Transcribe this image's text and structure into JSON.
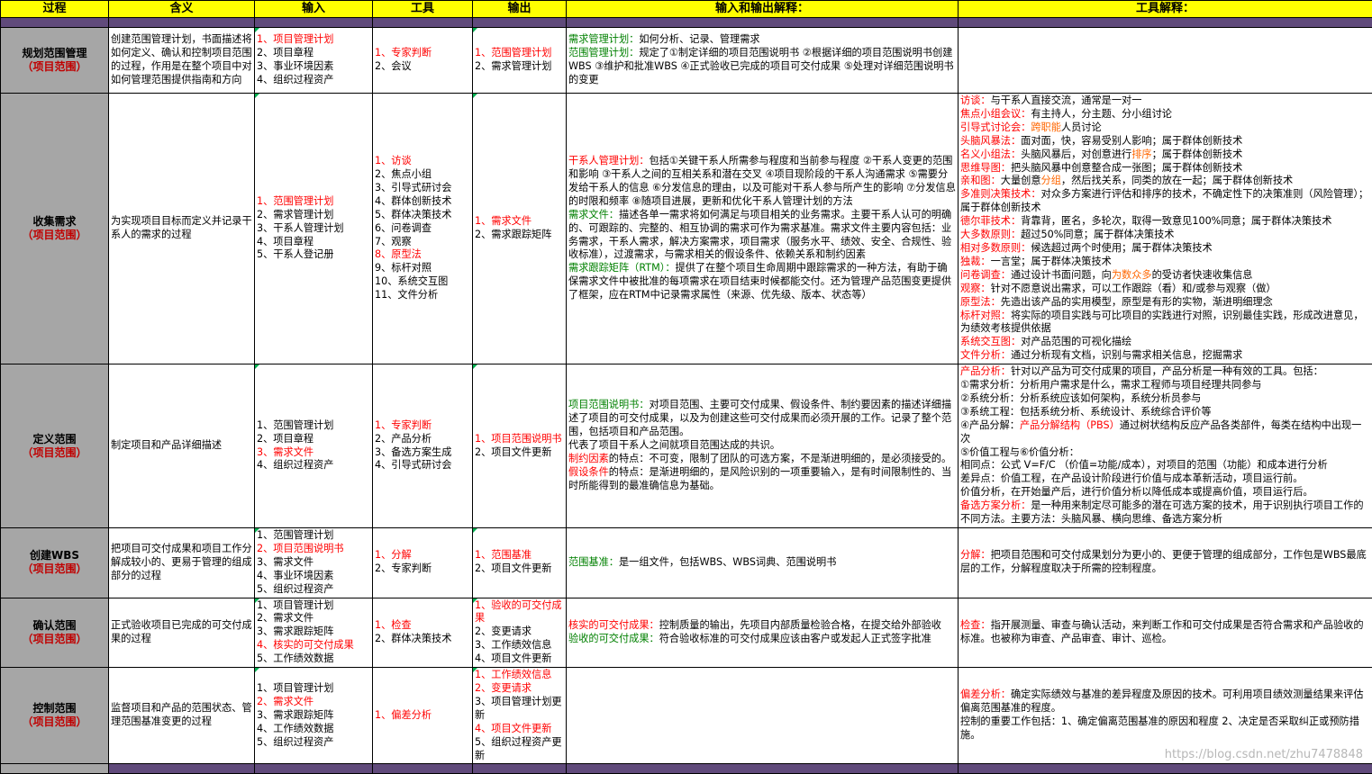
{
  "headers": [
    "过程",
    "含义",
    "输入",
    "工具",
    "输出",
    "输入和输出解释：",
    "工具解释："
  ],
  "rows": [
    {
      "process": "规划范围管理",
      "area": "（项目范围）",
      "meaning": "创建范围管理计划，书面描述将如何定义、确认和控制项目范围的过程，作用是在整个项目中对如何管理范围提供指南和方向",
      "inputs": [
        {
          "t": "1、项目管理计划",
          "c": "red"
        },
        {
          "t": "2、项目章程",
          "c": ""
        },
        {
          "t": "3、事业环境因素",
          "c": ""
        },
        {
          "t": "4、组织过程资产",
          "c": ""
        }
      ],
      "tools": [
        {
          "t": "1、专家判断",
          "c": "red"
        },
        {
          "t": "2、会议",
          "c": ""
        }
      ],
      "outputs": [
        {
          "t": "1、范围管理计划",
          "c": "red"
        },
        {
          "t": "2、需求管理计划",
          "c": ""
        }
      ],
      "io_explain": [
        [
          {
            "t": "需求管理计划：",
            "c": "green"
          },
          {
            "t": "如何分析、记录、管理需求",
            "c": ""
          }
        ],
        [
          {
            "t": "范围管理计划：",
            "c": "green"
          },
          {
            "t": "规定了①制定详细的项目范围说明书 ②根据详细的项目范围说明书创建WBS ③维护和批准WBS ④正式验收已完成的项目可交付成果 ⑤处理对详细范围说明书的变更",
            "c": ""
          }
        ]
      ],
      "tool_explain": []
    },
    {
      "process": "收集需求",
      "area": "（项目范围）",
      "meaning": "为实现项目目标而定义并记录干系人的需求的过程",
      "inputs": [
        {
          "t": "1、范围管理计划",
          "c": "red"
        },
        {
          "t": "2、需求管理计划",
          "c": ""
        },
        {
          "t": "3、干系人管理计划",
          "c": ""
        },
        {
          "t": "4、项目章程",
          "c": ""
        },
        {
          "t": "5、干系人登记册",
          "c": ""
        }
      ],
      "tools": [
        {
          "t": "1、访谈",
          "c": "red"
        },
        {
          "t": "2、焦点小组",
          "c": ""
        },
        {
          "t": "3、引导式研讨会",
          "c": ""
        },
        {
          "t": "4、群体创新技术",
          "c": ""
        },
        {
          "t": "5、群体决策技术",
          "c": ""
        },
        {
          "t": "6、问卷调查",
          "c": ""
        },
        {
          "t": "7、观察",
          "c": ""
        },
        {
          "t": "8、原型法",
          "c": "red"
        },
        {
          "t": "9、标杆对照",
          "c": ""
        },
        {
          "t": "10、系统交互图",
          "c": ""
        },
        {
          "t": "11、文件分析",
          "c": ""
        }
      ],
      "outputs": [
        {
          "t": "1、需求文件",
          "c": "red"
        },
        {
          "t": "2、需求跟踪矩阵",
          "c": ""
        }
      ],
      "io_explain": [
        [
          {
            "t": "干系人管理计划：",
            "c": "red"
          },
          {
            "t": "包括①关键干系人所需参与程度和当前参与程度 ②干系人变更的范围和影响 ③干系人之间的互相关系和潜在交叉 ④项目现阶段的干系人沟通需求 ⑤需要分发给干系人的信息 ⑥分发信息的理由，以及可能对干系人参与所产生的影响 ⑦分发信息的时限和频率 ⑧随项目进展，更新和优化干系人管理计划的方法",
            "c": ""
          }
        ],
        [
          {
            "t": "需求文件：",
            "c": "green"
          },
          {
            "t": "描述各单一需求将如何满足与项目相关的业务需求。主要干系人认可的明确的、可跟踪的、完整的、相互协调的需求可作为需求基准。需求文件主要内容包括：业务需求，干系人需求，解决方案需求，项目需求（服务水平、绩效、安全、合规性、验收标准），过渡需求，与需求相关的假设条件、依赖关系和制约因素",
            "c": ""
          }
        ],
        [
          {
            "t": "需求跟踪矩阵（RTM）：",
            "c": "green"
          },
          {
            "t": "提供了在整个项目生命周期中跟踪需求的一种方法，有助于确保需求文件中被批准的每项需求在项目结束时候都能交付。还为管理产品范围变更提供了框架，应在RTM中记录需求属性（来源、优先级、版本、状态等）",
            "c": ""
          }
        ]
      ],
      "tool_explain": [
        [
          {
            "t": "访谈：",
            "c": "red"
          },
          {
            "t": "与干系人直接交流，通常是一对一",
            "c": ""
          }
        ],
        [
          {
            "t": "焦点小组会议：",
            "c": "red"
          },
          {
            "t": "有主持人，分主题、分小组讨论",
            "c": ""
          }
        ],
        [
          {
            "t": "引导式讨论会：",
            "c": "red"
          },
          {
            "t": "跨职能",
            "c": "orange"
          },
          {
            "t": "人员讨论",
            "c": ""
          }
        ],
        [
          {
            "t": "头脑风暴法：",
            "c": "red"
          },
          {
            "t": "面对面，快，容易受别人影响；属于群体创新技术",
            "c": ""
          }
        ],
        [
          {
            "t": "名义小组法：",
            "c": "red"
          },
          {
            "t": "头脑风暴后，对创意进行",
            "c": ""
          },
          {
            "t": "排序",
            "c": "orange"
          },
          {
            "t": "；属于群体创新技术",
            "c": ""
          }
        ],
        [
          {
            "t": "思维导图：",
            "c": "red"
          },
          {
            "t": "把头脑风暴中创意整合成一张图；属于群体创新技术",
            "c": ""
          }
        ],
        [
          {
            "t": "亲和图：",
            "c": "red"
          },
          {
            "t": "大量创意",
            "c": ""
          },
          {
            "t": "分组",
            "c": "orange"
          },
          {
            "t": "，然后找关系，同类的放在一起；属于群体创新技术",
            "c": ""
          }
        ],
        [
          {
            "t": "多准则决策技术：",
            "c": "red"
          },
          {
            "t": "对众多方案进行评估和排序的技术，不确定性下的决策准则（风险管理）；属于群体创新技术",
            "c": ""
          }
        ],
        [
          {
            "t": "德尔菲技术：",
            "c": "red"
          },
          {
            "t": "背靠背，匿名，多轮次，取得一致意见100%同意；属于群体决策技术",
            "c": ""
          }
        ],
        [
          {
            "t": "大多数原则：",
            "c": "red"
          },
          {
            "t": "超过50%同意；属于群体决策技术",
            "c": ""
          }
        ],
        [
          {
            "t": "相对多数原则：",
            "c": "red"
          },
          {
            "t": "候选超过两个时使用；属于群体决策技术",
            "c": ""
          }
        ],
        [
          {
            "t": "独裁：",
            "c": "red"
          },
          {
            "t": "一言堂；属于群体决策技术",
            "c": ""
          }
        ],
        [
          {
            "t": "问卷调查：",
            "c": "red"
          },
          {
            "t": "通过设计书面问题，向",
            "c": ""
          },
          {
            "t": "为数众多",
            "c": "orange"
          },
          {
            "t": "的受访者快速收集信息",
            "c": ""
          }
        ],
        [
          {
            "t": "观察：",
            "c": "red"
          },
          {
            "t": "针对不愿意说出需求，可以工作跟踪（看）和/或参与观察（做）",
            "c": ""
          }
        ],
        [
          {
            "t": "原型法：",
            "c": "red"
          },
          {
            "t": "先造出该产品的实用模型，原型是有形的实物，渐进明细理念",
            "c": ""
          }
        ],
        [
          {
            "t": "标杆对照：",
            "c": "red"
          },
          {
            "t": "将实际的项目实践与可比项目的实践进行对照，识别最佳实践，形成改进意见，为绩效考核提供依据",
            "c": ""
          }
        ],
        [
          {
            "t": "系统交互图：",
            "c": "red"
          },
          {
            "t": "对产品范围的可视化描绘",
            "c": ""
          }
        ],
        [
          {
            "t": "文件分析：",
            "c": "red"
          },
          {
            "t": "通过分析现有文档，识别与需求相关信息，挖掘需求",
            "c": ""
          }
        ]
      ]
    },
    {
      "process": "定义范围",
      "area": "（项目范围）",
      "meaning": "制定项目和产品详细描述",
      "inputs": [
        {
          "t": "1、范围管理计划",
          "c": ""
        },
        {
          "t": "2、项目章程",
          "c": ""
        },
        {
          "t": "3、需求文件",
          "c": "red"
        },
        {
          "t": "4、组织过程资产",
          "c": ""
        }
      ],
      "tools": [
        {
          "t": "1、专家判断",
          "c": "red"
        },
        {
          "t": "2、产品分析",
          "c": ""
        },
        {
          "t": "3、备选方案生成",
          "c": ""
        },
        {
          "t": "4、引导式研讨会",
          "c": ""
        }
      ],
      "outputs": [
        {
          "t": "1、项目范围说明书",
          "c": "red"
        },
        {
          "t": "2、项目文件更新",
          "c": ""
        }
      ],
      "io_explain": [
        [
          {
            "t": "项目范围说明书：",
            "c": "green"
          },
          {
            "t": "对项目范围、主要可交付成果、假设条件、制约要因素的描述详细描述了项目的可交付成果，以及为创建这些可交付成果而必须开展的工作。记录了整个范围，包括项目和产品范围。",
            "c": ""
          }
        ],
        [
          {
            "t": "代表了项目干系人之间就项目范围达成的共识。",
            "c": ""
          }
        ],
        [
          {
            "t": "制约因素",
            "c": "red"
          },
          {
            "t": "的特点：不可变，限制了团队的可选方案，不是渐进明细的，是必须接受的。",
            "c": ""
          }
        ],
        [
          {
            "t": "假设条件",
            "c": "red"
          },
          {
            "t": "的特点：是渐进明细的，是风险识别的一项重要输入，是有时间限制性的、当时所能得到的最准确信息为基础。",
            "c": ""
          }
        ]
      ],
      "tool_explain": [
        [
          {
            "t": "产品分析：",
            "c": "red"
          },
          {
            "t": "针对以产品为可交付成果的项目，产品分析是一种有效的工具。包括：",
            "c": ""
          }
        ],
        [
          {
            "t": "①需求分析：分析用户需求是什么，需求工程师与项目经理共同参与",
            "c": ""
          }
        ],
        [
          {
            "t": "②系统分析：分析系统应该如何架构，系统分析员参与",
            "c": ""
          }
        ],
        [
          {
            "t": "③系统工程：包括系统分析、系统设计、系统综合评价等",
            "c": ""
          }
        ],
        [
          {
            "t": "④产品分解：",
            "c": ""
          },
          {
            "t": "产品分解结构（PBS）",
            "c": "red"
          },
          {
            "t": "通过树状结构反应产品各类部件，每类在结构中出现一次",
            "c": ""
          }
        ],
        [
          {
            "t": "⑤价值工程与⑥价值分析：",
            "c": ""
          }
        ],
        [
          {
            "t": "相同点：公式 V=F/C （价值=功能/成本），对项目的范围（功能）和成本进行分析",
            "c": ""
          }
        ],
        [
          {
            "t": "差异点：价值工程，在产品设计阶段进行价值与成本革新活动，项目运行前。",
            "c": ""
          }
        ],
        [
          {
            "t": "价值分析，在开始量产后，进行价值分析以降低成本或提高价值，项目运行后。",
            "c": ""
          }
        ],
        [
          {
            "t": "备选方案分析：",
            "c": "red"
          },
          {
            "t": "是一种用来制定尽可能多的潜在可选方案的技术，用于识别执行项目工作的不同方法。主要方法：头脑风暴、横向思维、备选方案分析",
            "c": ""
          }
        ]
      ]
    },
    {
      "process": "创建WBS",
      "area": "（项目范围）",
      "meaning": "把项目可交付成果和项目工作分解成较小的、更易于管理的组成部分的过程",
      "inputs": [
        {
          "t": "1、范围管理计划",
          "c": ""
        },
        {
          "t": "2、项目范围说明书",
          "c": "red"
        },
        {
          "t": "3、需求文件",
          "c": ""
        },
        {
          "t": "4、事业环境因素",
          "c": ""
        },
        {
          "t": "5、组织过程资产",
          "c": ""
        }
      ],
      "tools": [
        {
          "t": "1、分解",
          "c": "red"
        },
        {
          "t": "2、专家判断",
          "c": ""
        }
      ],
      "outputs": [
        {
          "t": "1、范围基准",
          "c": "red"
        },
        {
          "t": "2、项目文件更新",
          "c": ""
        }
      ],
      "io_explain": [
        [
          {
            "t": "范围基准：",
            "c": "green"
          },
          {
            "t": "是一组文件，包括WBS、WBS词典、范围说明书",
            "c": ""
          }
        ]
      ],
      "tool_explain": [
        [
          {
            "t": "分解：",
            "c": "red"
          },
          {
            "t": "把项目范围和可交付成果划分为更小的、更便于管理的组成部分，工作包是WBS最底层的工作，分解程度取决于所需的控制程度。",
            "c": ""
          }
        ]
      ]
    },
    {
      "process": "确认范围",
      "area": "（项目范围）",
      "meaning": "正式验收项目已完成的可交付成果的过程",
      "inputs": [
        {
          "t": "1、项目管理计划",
          "c": ""
        },
        {
          "t": "2、需求文件",
          "c": ""
        },
        {
          "t": "3、需求跟踪矩阵",
          "c": ""
        },
        {
          "t": "4、核实的可交付成果",
          "c": "red"
        },
        {
          "t": "5、工作绩效数据",
          "c": ""
        }
      ],
      "tools": [
        {
          "t": "1、检查",
          "c": "red"
        },
        {
          "t": "2、群体决策技术",
          "c": ""
        }
      ],
      "outputs": [
        {
          "t": "1、验收的可交付成果",
          "c": "red"
        },
        {
          "t": "2、变更请求",
          "c": ""
        },
        {
          "t": "3、工作绩效信息",
          "c": ""
        },
        {
          "t": "4、项目文件更新",
          "c": ""
        }
      ],
      "io_explain": [
        [
          {
            "t": "核实的可交付成果：",
            "c": "red"
          },
          {
            "t": "控制质量的输出，先项目内部质量检验合格，在提交给外部验收",
            "c": ""
          }
        ],
        [
          {
            "t": "验收的可交付成果：",
            "c": "green"
          },
          {
            "t": "符合验收标准的可交付成果应该由客户或发起人正式签字批准",
            "c": ""
          }
        ]
      ],
      "tool_explain": [
        [
          {
            "t": "检查：",
            "c": "red"
          },
          {
            "t": "指开展测量、审查与确认活动，来判断工作和可交付成果是否符合需求和产品验收的标准。也被称为审查、产品审查、审计、巡检。",
            "c": ""
          }
        ]
      ]
    },
    {
      "process": "控制范围",
      "area": "（项目范围）",
      "meaning": "监督项目和产品的范围状态、管理范围基准变更的过程",
      "inputs": [
        {
          "t": "1、项目管理计划",
          "c": ""
        },
        {
          "t": "2、需求文件",
          "c": "red"
        },
        {
          "t": "3、需求跟踪矩阵",
          "c": ""
        },
        {
          "t": "4、工作绩效数据",
          "c": ""
        },
        {
          "t": "5、组织过程资产",
          "c": ""
        }
      ],
      "tools": [
        {
          "t": "1、偏差分析",
          "c": "red"
        }
      ],
      "outputs": [
        {
          "t": "1、工作绩效信息",
          "c": "red"
        },
        {
          "t": "2、变更请求",
          "c": "red"
        },
        {
          "t": "3、项目管理计划更新",
          "c": ""
        },
        {
          "t": "4、项目文件更新",
          "c": "red"
        },
        {
          "t": "5、组织过程资产更新",
          "c": ""
        }
      ],
      "io_explain": [],
      "tool_explain": [
        [
          {
            "t": "偏差分析：",
            "c": "red"
          },
          {
            "t": "确定实际绩效与基准的差异程度及原因的技术。可利用项目绩效测量结果来评估偏离范围基准的程度。",
            "c": ""
          }
        ],
        [
          {
            "t": "控制的重要工作包括：1、确定偏离范围基准的原因和程度 2、决定是否采取纠正或预防措施。",
            "c": ""
          }
        ]
      ]
    }
  ],
  "watermark": "https://blog.csdn.net/zhu7478848"
}
